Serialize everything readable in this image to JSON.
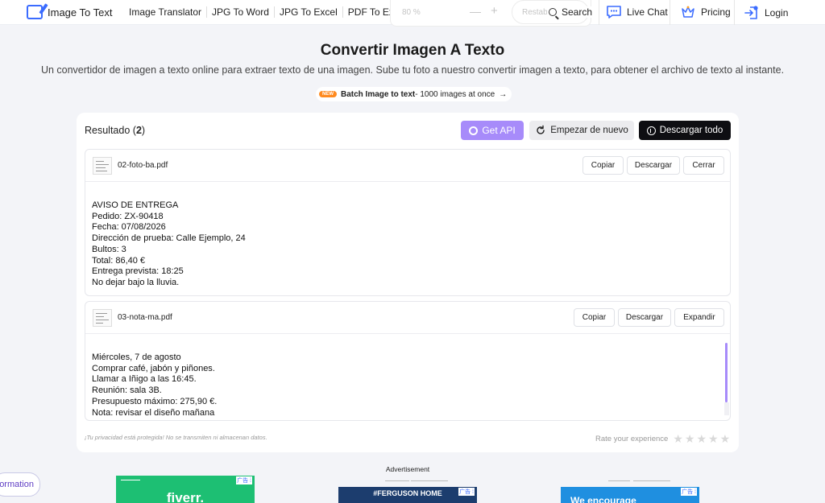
{
  "header": {
    "logo_text": "Image To Text",
    "nav": [
      "Image Translator",
      "JPG To Word",
      "JPG To Excel",
      "PDF To Excel"
    ],
    "zoom_value": "80 %",
    "zoom_minus": "—",
    "zoom_plus": "+",
    "zoom_reset": "Restab",
    "search": "Search",
    "live_chat": "Live Chat",
    "pricing": "Pricing",
    "login": "Login"
  },
  "page": {
    "title": "Convertir Imagen A Texto",
    "subtitle": "Un convertidor de imagen a texto online para extraer texto de una imagen. Sube tu foto a nuestro convertir imagen a texto, para obtener el archivo de texto al instante.",
    "batch_badge": "NEW",
    "batch_bold": "Batch Image to text",
    "batch_rest": " - 1000 images at once",
    "batch_arrow": "→"
  },
  "results": {
    "label": "Resultado (",
    "count": "2",
    "label_end": ")",
    "get_api": "Get API",
    "restart": "Empezar de nuevo",
    "download_all": "Descargar todo",
    "files": [
      {
        "name": "02-foto-ba.pdf",
        "buttons": [
          "Copiar",
          "Descargar",
          "Cerrar"
        ],
        "lines": [
          "AVISO DE ENTREGA",
          "Pedido: ZX-90418",
          "Fecha: 07/08/2026",
          "Dirección de prueba: Calle Ejemplo, 24",
          "Bultos: 3",
          "Total: 86,40 €",
          "Entrega prevista: 18:25",
          "No dejar bajo la lluvia."
        ]
      },
      {
        "name": "03-nota-ma.pdf",
        "buttons": [
          "Copiar",
          "Descargar",
          "Expandir"
        ],
        "lines": [
          "Miércoles, 7 de agosto",
          "Comprar café, jabón y piñones.",
          "Llamar a Iñigo a las 16:45.",
          "Reunión: sala 3B.",
          "Presupuesto máximo: 275,90 €.",
          "Nota: revisar el diseño mañana"
        ]
      }
    ],
    "privacy": "¡Tu privacidad está protegida! No se transmiten ni almacenan datos.",
    "rate": "Rate your experience",
    "stars": 5
  },
  "footer": {
    "info_button": "nformation",
    "ad_label": "Advertisement",
    "ads": [
      {
        "name": "fiverr.",
        "color": "#1dbf73",
        "tag": "广告 ⁞"
      },
      {
        "name": "#FERGUSON HOME",
        "color": "#1c3d6e",
        "tag": "广告 ⁞"
      },
      {
        "name": "We encourage",
        "color": "#1f8fe0",
        "tag": "广告 ⁞"
      }
    ]
  }
}
